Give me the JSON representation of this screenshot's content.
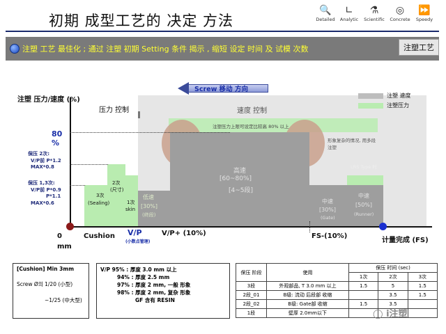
{
  "header": {
    "title": "初期 成型工艺的 决定 方法",
    "nav": [
      {
        "label": "Detailed",
        "icon": "magnifier-icon"
      },
      {
        "label": "Analytic",
        "icon": "chart-icon"
      },
      {
        "label": "Scientific",
        "icon": "microscope-icon"
      },
      {
        "label": "Concrete",
        "icon": "target-icon"
      },
      {
        "label": "Speedy",
        "icon": "fast-forward-icon"
      }
    ]
  },
  "banner": {
    "text": "注塑 工艺 最佳化 ; 通过 注塑 初期 Setting 条件 揭示 , 缩短 设定 时间 及 试模 次数",
    "tag": "注塑工艺"
  },
  "chart": {
    "ylabel": "注塑 压力/速度 (%)",
    "screw_arrow": "Screw 移动 方向",
    "pressure_ctrl": "压力 控制",
    "speed_ctrl": "速度 控制",
    "legend": [
      {
        "label": "注塑 速度",
        "color": "#bdbdbd"
      },
      {
        "label": "注塑压力",
        "color": "#b9ecb0"
      }
    ],
    "pct80": "80 %",
    "note_80": "注塑压力上限可设定比较高 80% 以上",
    "note_shape": "形象复杂的情况, 用多段注塑",
    "center_label": "高速",
    "center_range": "[60~80%]",
    "center_stage": "[4~5段]",
    "lrs_type": "LRS Type 时",
    "hold2": "保压 2次:",
    "hold2_a": "V/P前 P*1.2",
    "hold2_b": "MAX*0.8",
    "hold1": "保压 1,3次:",
    "hold1_a": "V/P前 P*0.9",
    "hold1_b": "P*1.1",
    "hold1_c": "MAX*0.6",
    "step3": "3次",
    "step3b": "(Sealing)",
    "step2": "2次",
    "step2b": "(尺寸)",
    "step1": "1次",
    "step1b": "skin",
    "low1": "低速",
    "low1_pct": "[30%]",
    "low1_name": "(终段)",
    "mid": "中速",
    "mid_pct": "[30%]",
    "mid_name": "(Gate)",
    "mid2": "中速",
    "mid2_pct": "[50%]",
    "mid2_name": "(Runner)",
    "x0": "0 mm",
    "cushion": "Cushion",
    "vp": "V/P",
    "vp_sub": "(小数点管理)",
    "vp_plus": "V/P+ (10%)",
    "fs": "FS-(10%)",
    "meter_done": "计量完成 (FS)"
  },
  "cushion_box": {
    "line1": "[Cushion] Min 3mm",
    "line2": "Screw Ø의 1/20 (小型)",
    "line3": "~1/25 (中大型)"
  },
  "vp_box": {
    "lines": [
      "V/P 95% : 厚度 3.0 mm 以上",
      "94% : 厚度 2.5 mm",
      "97% : 厚度 2 mm, 一般 形象",
      "98% : 厚度 2 mm, 复杂 形象",
      "GF 含有 RESIN"
    ]
  },
  "hold_table": {
    "h_stage": "保压 阶段",
    "h_use": "使用",
    "h_time": "保压 时间 (sec)",
    "h_cols": [
      "1次",
      "2次",
      "3次"
    ],
    "rows": [
      {
        "stage": "3段",
        "use": "外观部品, T 3.0 mm 以上",
        "t": [
          "1.5",
          "5",
          "1.5"
        ]
      },
      {
        "stage": "2段_01",
        "use": "B级: 流动 后段部 收缩",
        "t": [
          "",
          "3.5",
          "1.5"
        ]
      },
      {
        "stage": "2段_02",
        "use": "B级: Gate部 收缩",
        "t": [
          "1.5",
          "3.5",
          ""
        ]
      },
      {
        "stage": "1段",
        "use": "壁厚 2.0mm以下",
        "t": [
          "",
          "",
          ""
        ]
      }
    ]
  },
  "watermark": "i注塑"
}
